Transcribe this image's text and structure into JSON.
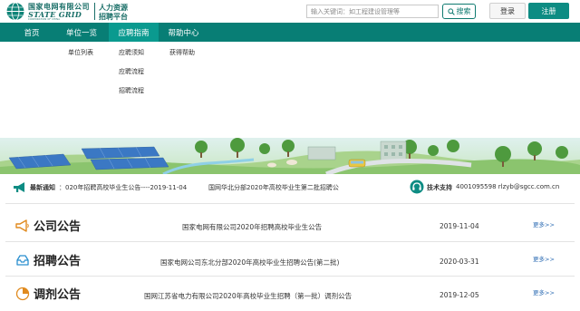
{
  "brand": {
    "name_cn": "国家电网有限公司",
    "name_en": "STATE GRID",
    "name_en_sub": "CORPORATION OF CHINA",
    "sub1": "人力资源",
    "sub2": "招聘平台",
    "color": "#1a6f68"
  },
  "search": {
    "placeholder": "输入关键词：如工程建设管理等",
    "button_label": "搜索"
  },
  "auth": {
    "login_label": "登录",
    "register_label": "注册"
  },
  "nav": {
    "color": "#087e75",
    "active_color": "#0a9a8f",
    "items": [
      {
        "label": "首页"
      },
      {
        "label": "单位一览"
      },
      {
        "label": "应聘指南"
      },
      {
        "label": "帮助中心"
      }
    ]
  },
  "dropdown": {
    "units": [
      "单位列表"
    ],
    "guide": [
      "应聘须知",
      "应聘流程",
      "招聘流程"
    ],
    "help": [
      "获得帮助"
    ]
  },
  "ticker": {
    "label": "最新通知",
    "colon": "：",
    "item1": "020年招聘高校毕业生公告----2019-11-04",
    "item2": "国网华北分部2020年高校毕业生第二批招聘公"
  },
  "support": {
    "label": "技术支持",
    "value": "4001095598  rlzyb@sgcc.com.cn"
  },
  "sections": [
    {
      "title": "公司公告",
      "icon": "megaphone-icon",
      "item": "国家电网有限公司2020年招聘高校毕业生公告",
      "date": "2019-11-04",
      "more": "更多>>"
    },
    {
      "title": "招聘公告",
      "icon": "inbox-icon",
      "item": "国家电网公司东北分部2020年高校毕业生招聘公告(第二批)",
      "date": "2020-03-31",
      "more": "更多>>"
    },
    {
      "title": "调剂公告",
      "icon": "adjust-icon",
      "item": "国网江苏省电力有限公司2020年高校毕业生招聘（第一批）调剂公告",
      "date": "2019-12-05",
      "more": "更多>>"
    }
  ]
}
